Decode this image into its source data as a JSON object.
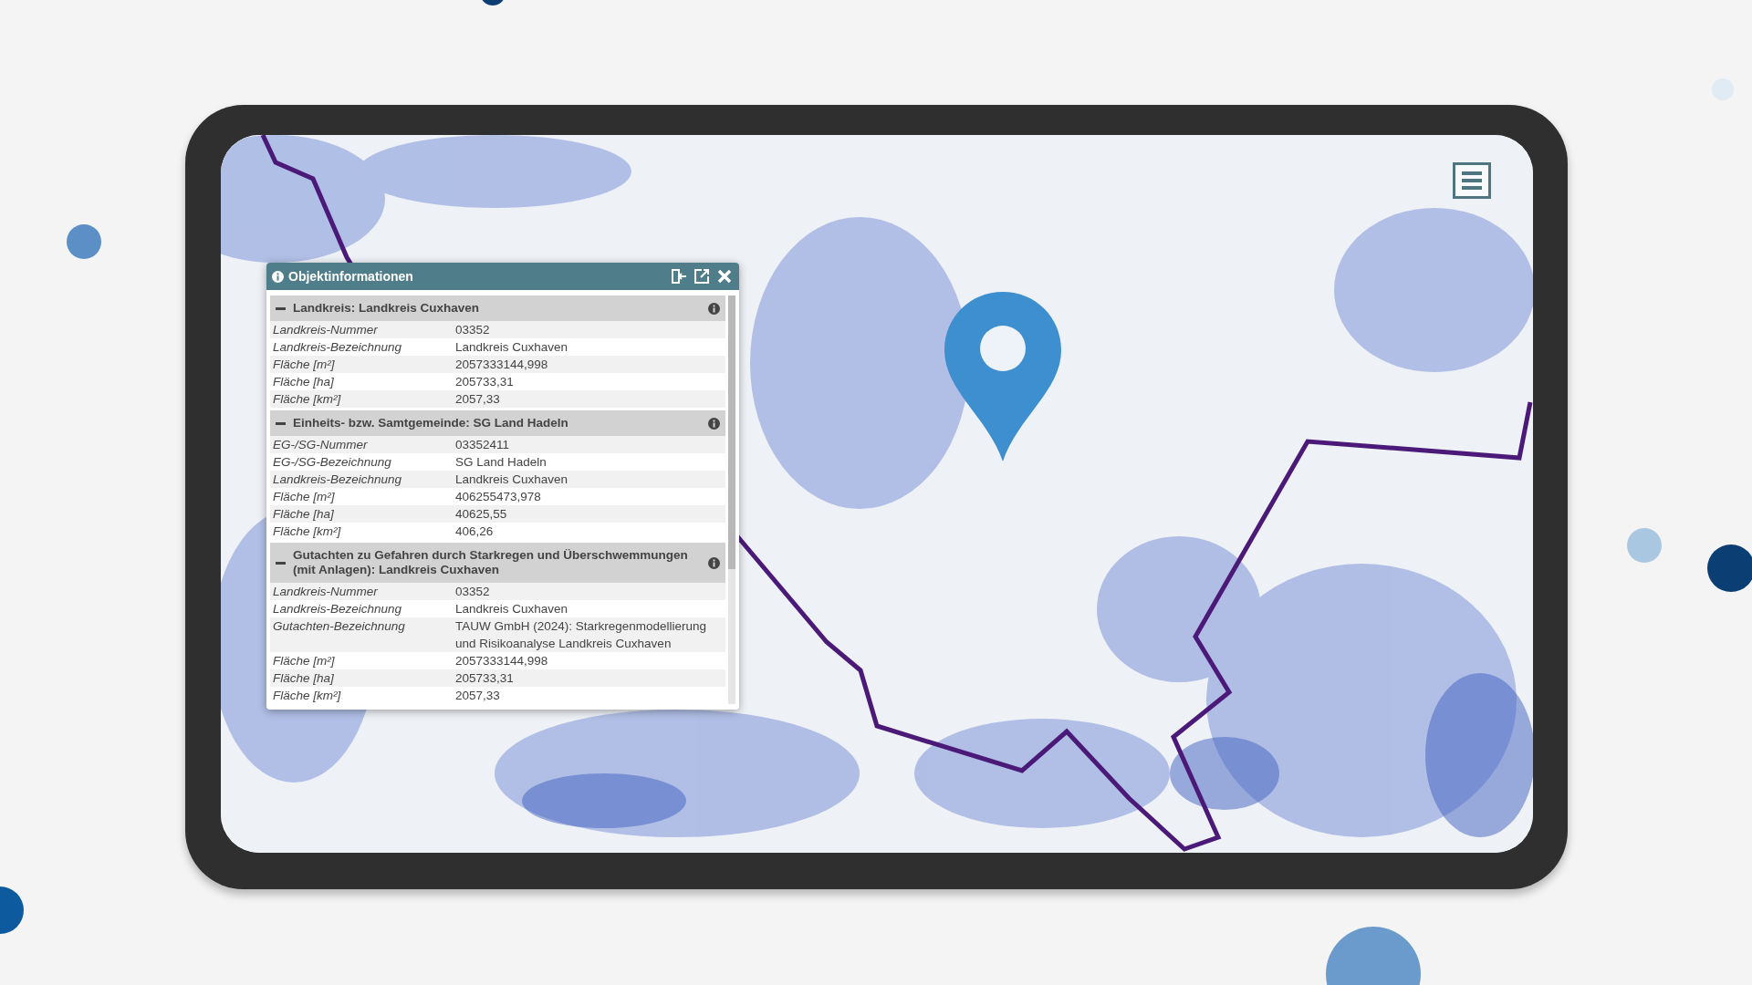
{
  "popup": {
    "title": "Objektinformationen",
    "sections": [
      {
        "title": "Landkreis: Landkreis Cuxhaven",
        "expanded": true,
        "rows": [
          {
            "label": "Landkreis-Nummer",
            "value": "03352"
          },
          {
            "label": "Landkreis-Bezeichnung",
            "value": "Landkreis Cuxhaven"
          },
          {
            "label": "Fläche [m²]",
            "value": "2057333144,998"
          },
          {
            "label": "Fläche [ha]",
            "value": "205733,31"
          },
          {
            "label": "Fläche [km²]",
            "value": "2057,33"
          }
        ]
      },
      {
        "title": "Einheits- bzw. Samtgemeinde: SG Land Hadeln",
        "expanded": true,
        "rows": [
          {
            "label": "EG-/SG-Nummer",
            "value": "03352411"
          },
          {
            "label": "EG-/SG-Bezeichnung",
            "value": "SG Land Hadeln"
          },
          {
            "label": "Landkreis-Bezeichnung",
            "value": "Landkreis Cuxhaven"
          },
          {
            "label": "Fläche [m²]",
            "value": "406255473,978"
          },
          {
            "label": "Fläche [ha]",
            "value": "40625,55"
          },
          {
            "label": "Fläche [km²]",
            "value": "406,26"
          }
        ]
      },
      {
        "title": "Gutachten zu Gefahren durch Starkregen und Überschwemmungen (mit Anlagen): Landkreis Cuxhaven",
        "expanded": true,
        "rows": [
          {
            "label": "Landkreis-Nummer",
            "value": "03352"
          },
          {
            "label": "Landkreis-Bezeichnung",
            "value": "Landkreis Cuxhaven"
          },
          {
            "label": "Gutachten-Bezeichnung",
            "value": "TAUW GmbH (2024): Starkregenmodellierung und Risikoanalyse Landkreis Cuxhaven"
          },
          {
            "label": "Fläche [m²]",
            "value": "2057333144,998"
          },
          {
            "label": "Fläche [ha]",
            "value": "205733,31"
          },
          {
            "label": "Fläche [km²]",
            "value": "2057,33"
          }
        ]
      }
    ]
  }
}
